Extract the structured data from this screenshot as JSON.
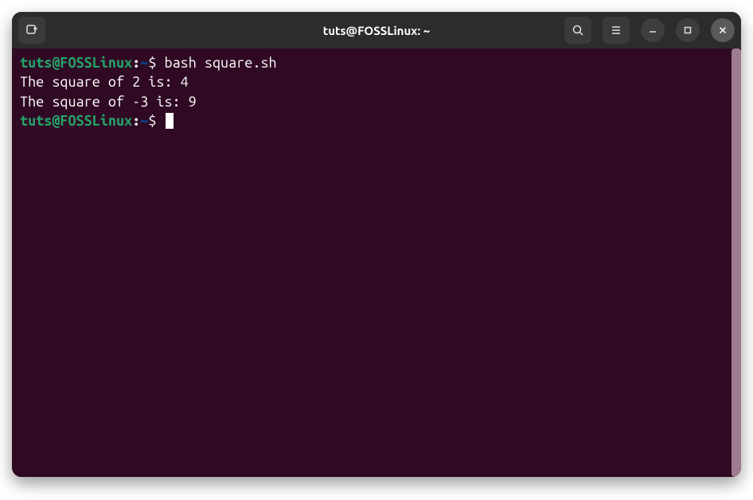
{
  "window": {
    "title": "tuts@FOSSLinux: ~"
  },
  "terminal": {
    "lines": [
      {
        "prompt": {
          "user": "tuts@FOSSLinux",
          "path": "~",
          "symbol": "$"
        },
        "command": "bash square.sh"
      },
      {
        "output": "The square of 2 is: 4"
      },
      {
        "output": "The square of -3 is: 9"
      },
      {
        "prompt": {
          "user": "tuts@FOSSLinux",
          "path": "~",
          "symbol": "$"
        },
        "command": "",
        "cursor": true
      }
    ]
  }
}
